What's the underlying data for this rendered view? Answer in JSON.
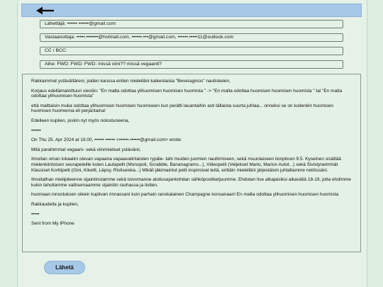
{
  "icons": {
    "back": "back-arrow-icon"
  },
  "colors": {
    "background": "#dcefe0",
    "topbar": "#a8c8e8",
    "send_button": "#a8c8e8"
  },
  "fields": {
    "from": "Lähettäjä: •••••• ••••••@gmail.com",
    "to": "Vastaanottaja: •••••.•••••••@hotmail.com, ••••••.•••@gmail.com, ••••••.•••••11@outlook.com",
    "cc": "CC / BCC:",
    "subject": "Aihe: FWD: FWD: FWD: missä viini?? missä vegaanit?"
  },
  "body": {
    "paragraphs": [
      "Rakkaimmat ystävättäreni, joiden kanssa eniten mielelläni kaikenlaisia \"Beveraginos\" nautiskelen,",
      "Korjaus edellämainittuun viestiin: \"En malta odottaa ylihuomisen huomisen huomista \" -> \"En malta odottaa huomisen huomisen huomista \" tai \"En malta odottaa ylihuomisen huomista\"",
      "että malttaisin muka odottaa ylihuomisen huomisen huomiseen kun perätti lauantaihin asti tällaista suurta juhlaa... onneksi se on kuitenkin huomisen huomisen huomenna eli perjantaina!",
      "Edelleen kuplien, joskin nyt myös nolostuneena,",
      "••••••",
      "On Thu 25. Apr 2024 at 19.00, •••••• •••••• <••••••.••••••@gmail.com> wrote:",
      "Mitä parahimmat vegaani- sekä viinimieliset ystävänii,",
      "Ilmoitan oman lukaalini olevan vapaana vapaavalintaisten rypäle- tahi muiden juomien nauttimiseen, sekä muunlaiseen ilonpitoon 9.5. Kyseinen sisältää mielenkiintoisen seurapeleille kuten Lautapelit (Monopoli, Scrabble, Bananagrams...), Videopelit (Veljekset Mario, Marion Autot...) sekä Sivistyneimmät Klassiset Korttipelit (Gini, Kikettl, Läpsy, Ristiseiska...) Mikäli jäkimaintut pelit inspiroivat teitä, erittäin mielelläni järjestäisin juhlaltamme neliössäni.",
      "Ilmoitathan mielipiteenne sijaintinstamme sekä toivomanne aloitusajankohdan sähköpostiketjuumme. Ehdotan itse alkajaisiksi aikaväliä 18-19, jotta ehdimme kukin tahollamme valitsemaamme sijaintiin rauhassa ja iloiten.",
      "huomaan innostuksen oikein kuplivan rinnassani kuin parhain ranskalainen Champagne konsanaan! En malta odottaa ylihuomisen huomisen huomista",
      "Rakkaudella ja kuplien,",
      "•••••",
      "Sent from My iPhone"
    ]
  },
  "send_label": "Lähetä"
}
